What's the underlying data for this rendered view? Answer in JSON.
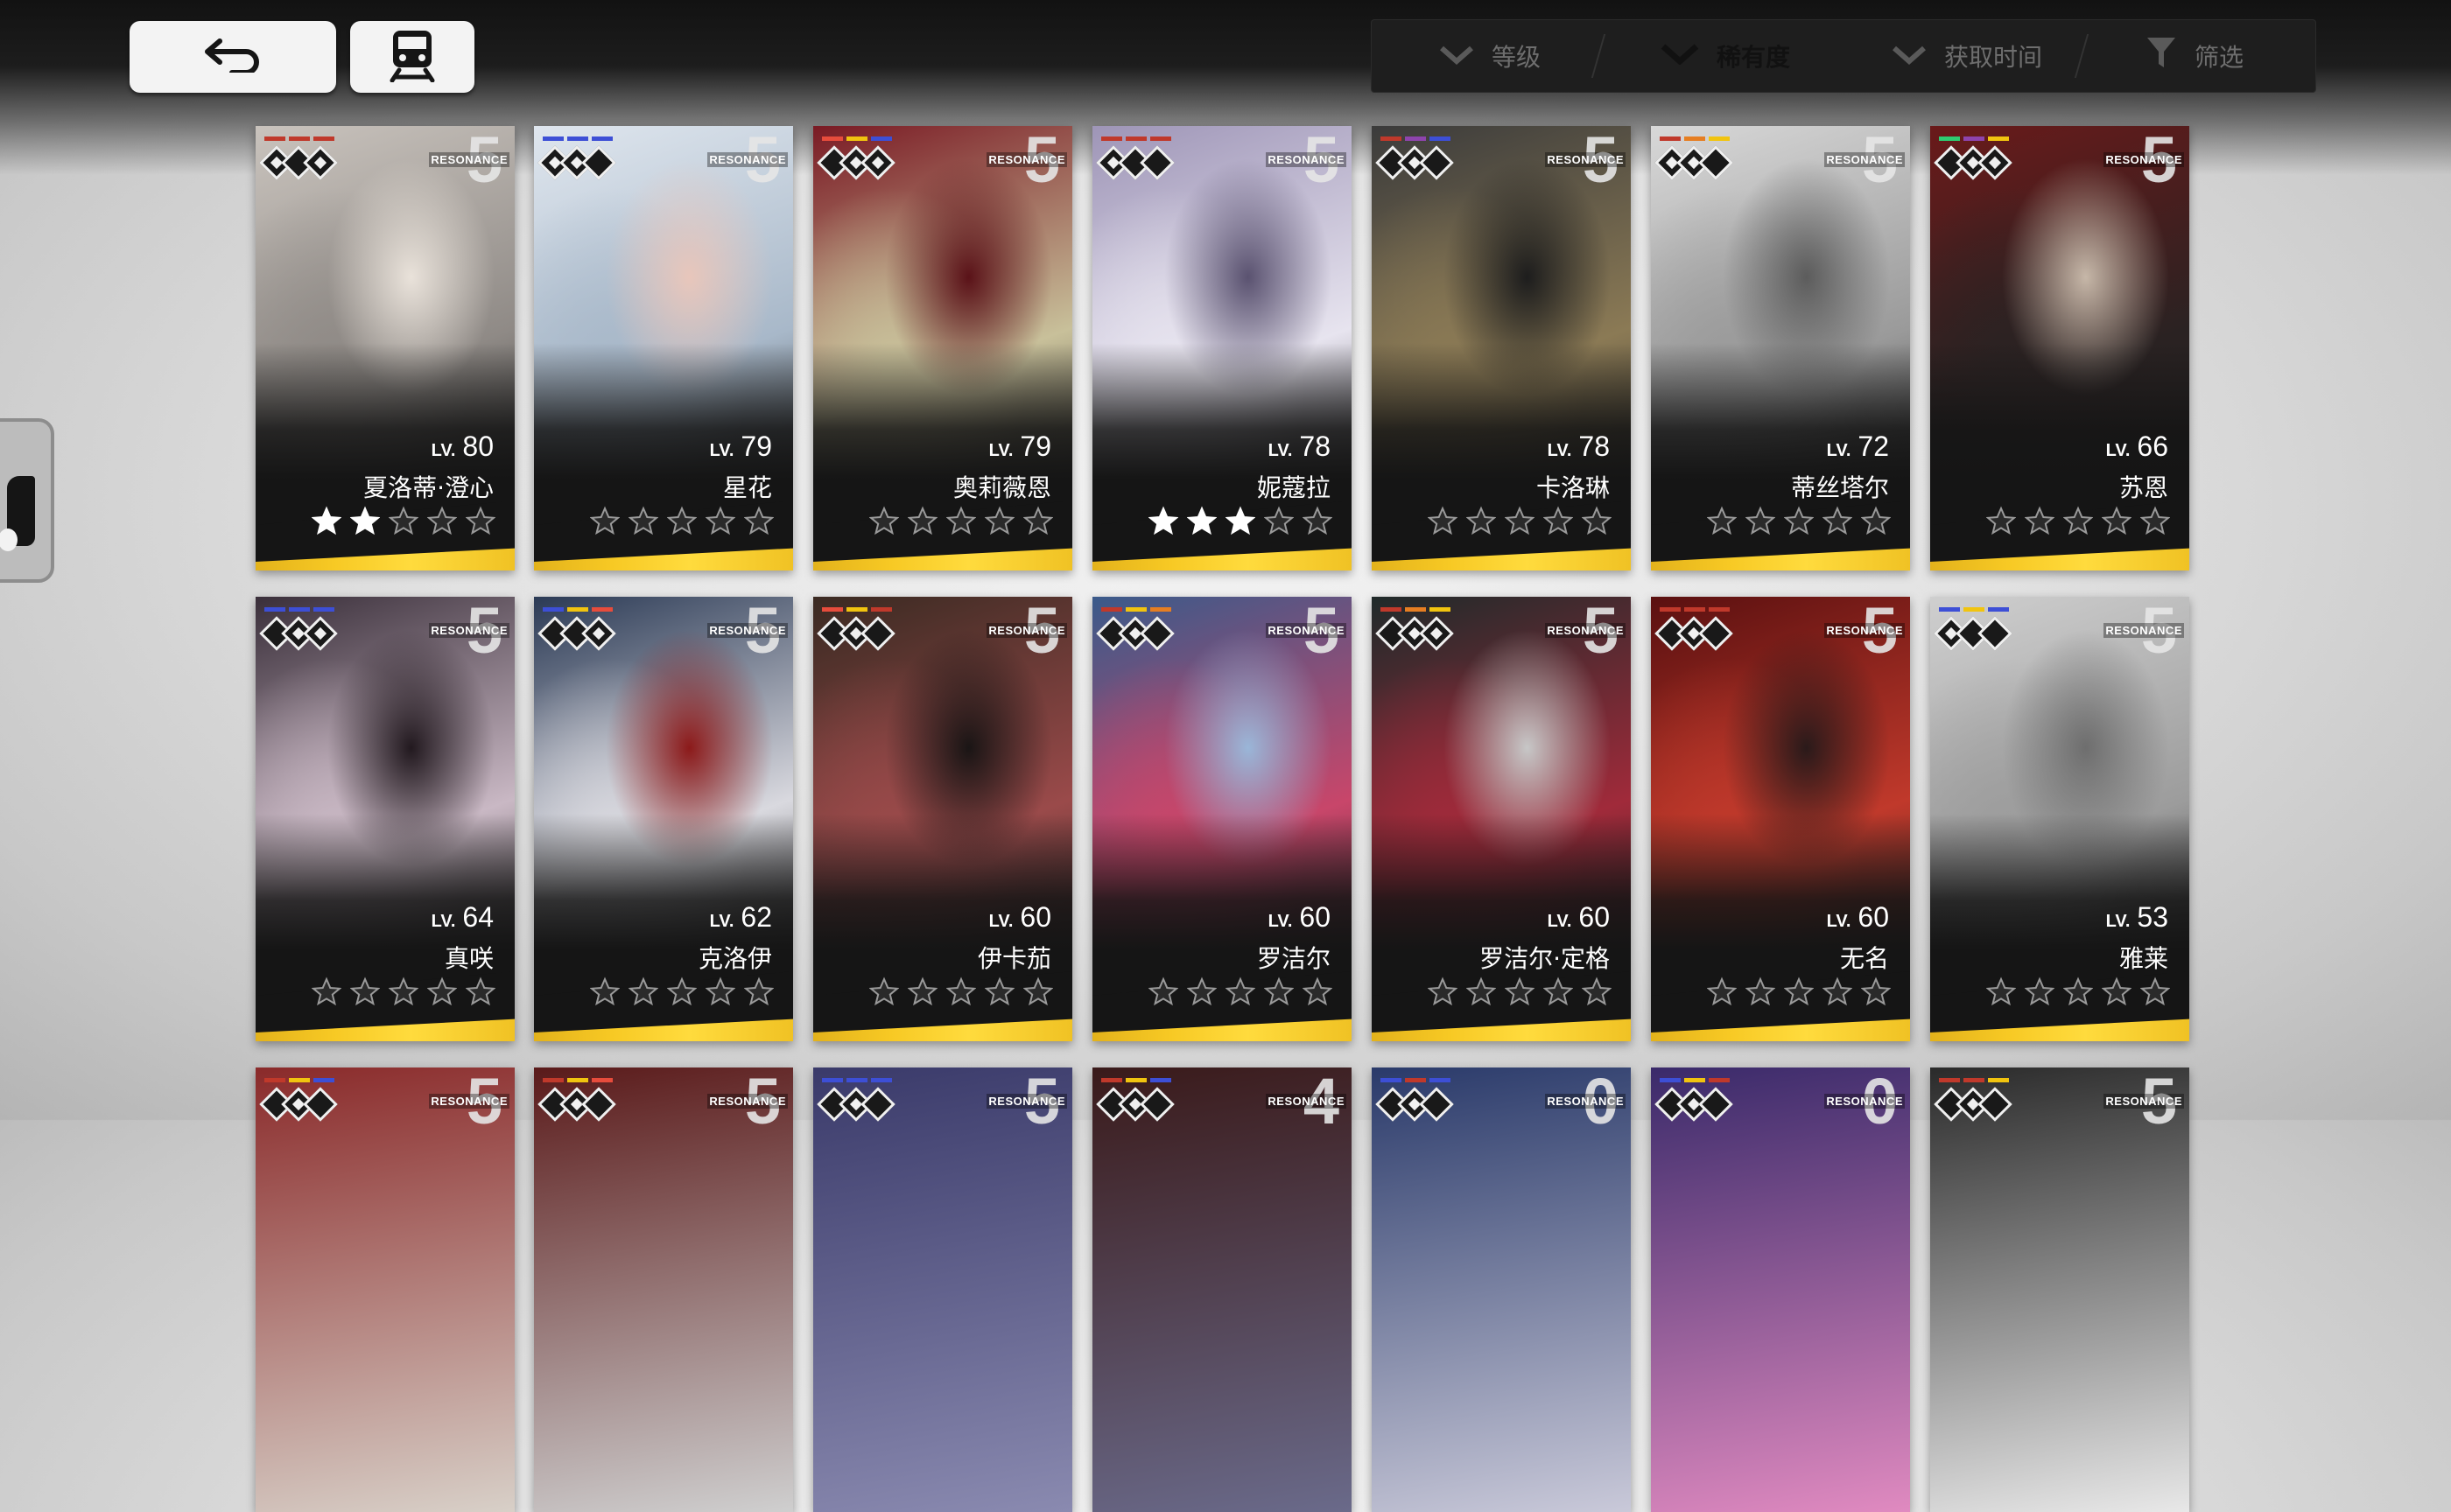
{
  "nav": {
    "back_icon": "back-arrow-icon",
    "base_icon": "train-icon"
  },
  "sort_bar": {
    "tabs": [
      {
        "label": "等级",
        "icon": "chevron-down-icon",
        "active": false
      },
      {
        "label": "稀有度",
        "icon": "chevron-down-icon",
        "active": true
      },
      {
        "label": "获取时间",
        "icon": "chevron-down-icon",
        "active": false
      },
      {
        "label": "筛选",
        "icon": "filter-icon",
        "active": false
      }
    ]
  },
  "colors": {
    "accent_gold": "#f7c924",
    "card_dark": "#151515",
    "active_tab": "#f2f2f2"
  },
  "resonance_label": "RESONANCE",
  "level_prefix": "LV.",
  "characters": [
    {
      "name": "夏洛蒂·澄心",
      "level": "80",
      "resonance": "5",
      "stars_filled": 2,
      "stars_total": 5,
      "diamonds_filled": [
        true,
        false,
        true
      ],
      "palette": [
        "#c9c3bd",
        "#8f8a86",
        "#e9e2da"
      ],
      "bars": [
        "#c0392b",
        "#c0392b",
        "#c0392b"
      ]
    },
    {
      "name": "星花",
      "level": "79",
      "resonance": "5",
      "stars_filled": 0,
      "stars_total": 5,
      "diamonds_filled": [
        true,
        true,
        false
      ],
      "palette": [
        "#dfe6ee",
        "#a8b8c9",
        "#e8c6bb"
      ],
      "bars": [
        "#3d4fd6",
        "#3d4fd6",
        "#3d4fd6"
      ]
    },
    {
      "name": "奥莉薇恩",
      "level": "79",
      "resonance": "5",
      "stars_filled": 0,
      "stars_total": 5,
      "diamonds_filled": [
        false,
        true,
        true
      ],
      "palette": [
        "#7a1a24",
        "#c8c09a",
        "#5a1218"
      ],
      "bars": [
        "#e74c3c",
        "#f1c40f",
        "#3d4fd6"
      ]
    },
    {
      "name": "妮蔻拉",
      "level": "78",
      "resonance": "5",
      "stars_filled": 3,
      "stars_total": 5,
      "diamonds_filled": [
        true,
        false,
        false
      ],
      "palette": [
        "#9e95b7",
        "#e7e4ef",
        "#5a5270"
      ],
      "bars": [
        "#c0392b",
        "#c0392b",
        "#c0392b"
      ]
    },
    {
      "name": "卡洛琳",
      "level": "78",
      "resonance": "5",
      "stars_filled": 0,
      "stars_total": 5,
      "diamonds_filled": [
        false,
        true,
        false
      ],
      "palette": [
        "#3b3b3b",
        "#8b7a55",
        "#1d1d1d"
      ],
      "bars": [
        "#c0392b",
        "#8e44ad",
        "#3d4fd6"
      ]
    },
    {
      "name": "蒂丝塔尔",
      "level": "72",
      "resonance": "5",
      "stars_filled": 0,
      "stars_total": 5,
      "diamonds_filled": [
        true,
        true,
        false
      ],
      "palette": [
        "#d8d8d8",
        "#9a9a9a",
        "#5c5c5c"
      ],
      "bars": [
        "#c0392b",
        "#e67e22",
        "#f1c40f"
      ]
    },
    {
      "name": "苏恩",
      "level": "66",
      "resonance": "5",
      "stars_filled": 0,
      "stars_total": 5,
      "diamonds_filled": [
        false,
        true,
        true
      ],
      "palette": [
        "#6a1a1a",
        "#2a2222",
        "#c6b7a8"
      ],
      "bars": [
        "#2ecc71",
        "#8e44ad",
        "#f1c40f"
      ]
    },
    {
      "name": "真咲",
      "level": "64",
      "resonance": "5",
      "stars_filled": 0,
      "stars_total": 5,
      "diamonds_filled": [
        false,
        true,
        true
      ],
      "palette": [
        "#3a2f3a",
        "#c9b8c4",
        "#22191f"
      ],
      "bars": [
        "#3d4fd6",
        "#3d4fd6",
        "#3d4fd6"
      ]
    },
    {
      "name": "克洛伊",
      "level": "62",
      "resonance": "5",
      "stars_filled": 0,
      "stars_total": 5,
      "diamonds_filled": [
        false,
        false,
        true
      ],
      "palette": [
        "#2b3a55",
        "#d9d9df",
        "#8c1a1a"
      ],
      "bars": [
        "#3d4fd6",
        "#f1c40f",
        "#e74c3c"
      ]
    },
    {
      "name": "伊卡茄",
      "level": "60",
      "resonance": "5",
      "stars_filled": 0,
      "stars_total": 5,
      "diamonds_filled": [
        false,
        true,
        false
      ],
      "palette": [
        "#3a2a22",
        "#9a4a4a",
        "#1a1515"
      ],
      "bars": [
        "#e74c3c",
        "#f1c40f",
        "#c0392b"
      ]
    },
    {
      "name": "罗洁尔",
      "level": "60",
      "resonance": "5",
      "stars_filled": 0,
      "stars_total": 5,
      "diamonds_filled": [
        false,
        true,
        false
      ],
      "palette": [
        "#3a5a8a",
        "#c8466a",
        "#9ab6d8"
      ],
      "bars": [
        "#c0392b",
        "#f1c40f",
        "#e67e22"
      ]
    },
    {
      "name": "罗洁尔·定格",
      "level": "60",
      "resonance": "5",
      "stars_filled": 0,
      "stars_total": 5,
      "diamonds_filled": [
        false,
        true,
        true
      ],
      "palette": [
        "#1f2a2a",
        "#a02a3a",
        "#c7c7c7"
      ],
      "bars": [
        "#c0392b",
        "#e67e22",
        "#f1c40f"
      ]
    },
    {
      "name": "无名",
      "level": "60",
      "resonance": "5",
      "stars_filled": 0,
      "stars_total": 5,
      "diamonds_filled": [
        false,
        true,
        false
      ],
      "palette": [
        "#5a1010",
        "#c0392b",
        "#2a1a1a"
      ],
      "bars": [
        "#c0392b",
        "#c0392b",
        "#c0392b"
      ]
    },
    {
      "name": "雅莱",
      "level": "53",
      "resonance": "5",
      "stars_filled": 0,
      "stars_total": 5,
      "diamonds_filled": [
        true,
        false,
        false
      ],
      "palette": [
        "#cfcfcf",
        "#9c9c9c",
        "#6e6e6e"
      ],
      "bars": [
        "#3d4fd6",
        "#f1c40f",
        "#3d4fd6"
      ]
    }
  ],
  "partial_row": [
    {
      "resonance": "5",
      "palette": [
        "#8a2a2a",
        "#d8d0c8"
      ],
      "bars": [
        "#c0392b",
        "#f1c40f",
        "#3d4fd6"
      ]
    },
    {
      "resonance": "5",
      "palette": [
        "#5a1a1a",
        "#cfcfcf"
      ],
      "bars": [
        "#c0392b",
        "#f1c40f",
        "#e74c3c"
      ]
    },
    {
      "resonance": "5",
      "palette": [
        "#3a3a6a",
        "#8a8ab0"
      ],
      "bars": [
        "#3d4fd6",
        "#3d4fd6",
        "#3d4fd6"
      ]
    },
    {
      "resonance": "4",
      "palette": [
        "#3a1a1a",
        "#6a6a8a"
      ],
      "bars": [
        "#c0392b",
        "#f1c40f",
        "#3d4fd6"
      ]
    },
    {
      "resonance": "0",
      "palette": [
        "#2a3a6a",
        "#c9c9d9"
      ],
      "bars": [
        "#3d4fd6",
        "#c0392b",
        "#3d4fd6"
      ]
    },
    {
      "resonance": "0",
      "palette": [
        "#3a2a6a",
        "#e08ac0"
      ],
      "bars": [
        "#3d4fd6",
        "#f1c40f",
        "#c0392b"
      ]
    },
    {
      "resonance": "5",
      "palette": [
        "#2a2a2a",
        "#e8e8e8"
      ],
      "bars": [
        "#c0392b",
        "#c0392b",
        "#f1c40f"
      ]
    }
  ]
}
